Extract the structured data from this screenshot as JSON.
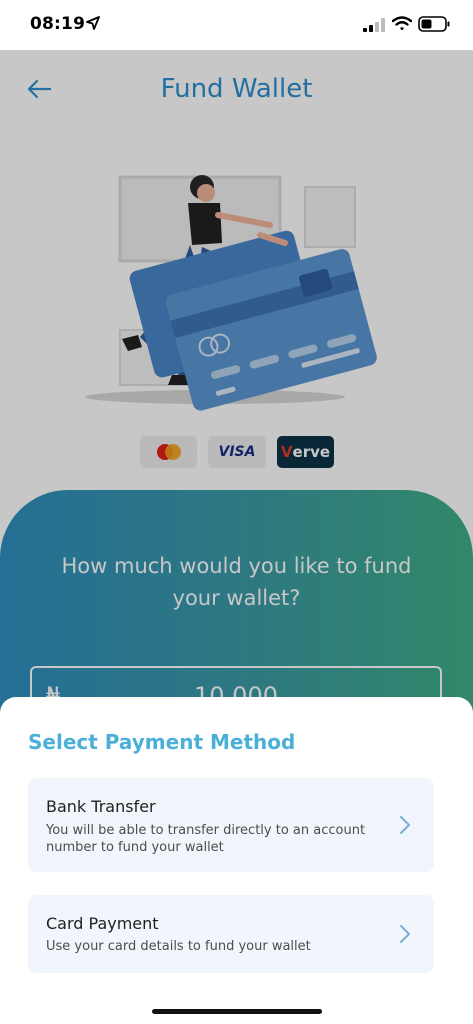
{
  "status_bar": {
    "time": "08:19",
    "icons": [
      "location-arrow-icon",
      "cellular-signal-icon",
      "wifi-icon",
      "battery-icon"
    ]
  },
  "header": {
    "back_icon": "back-arrow-icon",
    "title": "Fund Wallet"
  },
  "illustration": "woman-pushing-credit-cards-illustration",
  "card_brands": {
    "mastercard": "mastercard",
    "visa": "VISA",
    "verve_v": "V",
    "verve_rest": "erve"
  },
  "fund_form": {
    "question": "How much would you like to fund your wallet?",
    "currency": "₦",
    "amount": "10,000"
  },
  "payment_sheet": {
    "title": "Select Payment Method",
    "options": [
      {
        "title": "Bank Transfer",
        "description": "You will be able to transfer directly to an account number to fund your wallet",
        "icon": "chevron-right-icon"
      },
      {
        "title": "Card Payment",
        "description": "Use your card details to fund your wallet",
        "icon": "chevron-right-icon"
      }
    ]
  },
  "colors": {
    "accent": "#2f8fcf",
    "sheet_title": "#4bb0d8",
    "option_bg": "#f0f6fb",
    "gradient_start": "#2f8fbf",
    "gradient_end": "#3fae86"
  }
}
